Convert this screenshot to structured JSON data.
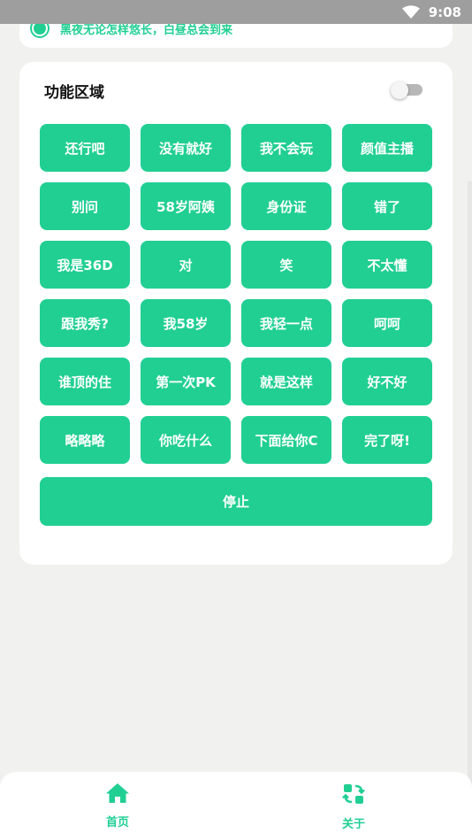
{
  "status_bar": {
    "time": "9:08"
  },
  "notice": {
    "text": "黑夜无论怎样悠长，白昼总会到来"
  },
  "function_area": {
    "title": "功能区域",
    "toggle_on": false,
    "buttons": [
      "还行吧",
      "没有就好",
      "我不会玩",
      "颜值主播",
      "别问",
      "58岁阿姨",
      "身份证",
      "错了",
      "我是36D",
      "对",
      "笑",
      "不太懂",
      "跟我秀?",
      "我58岁",
      "我轻一点",
      "呵呵",
      "谁顶的住",
      "第一次PK",
      "就是这样",
      "好不好",
      "略略略",
      "你吃什么",
      "下面给你C",
      "完了呀!"
    ],
    "stop_label": "停止"
  },
  "bottom_nav": {
    "items": [
      {
        "label": "首页",
        "icon": "home-icon"
      },
      {
        "label": "关于",
        "icon": "swap-icon"
      }
    ]
  },
  "colors": {
    "accent": "#21cf93",
    "background": "#f1f2f0",
    "card": "#ffffff",
    "status_bar": "#9e9e9e"
  }
}
